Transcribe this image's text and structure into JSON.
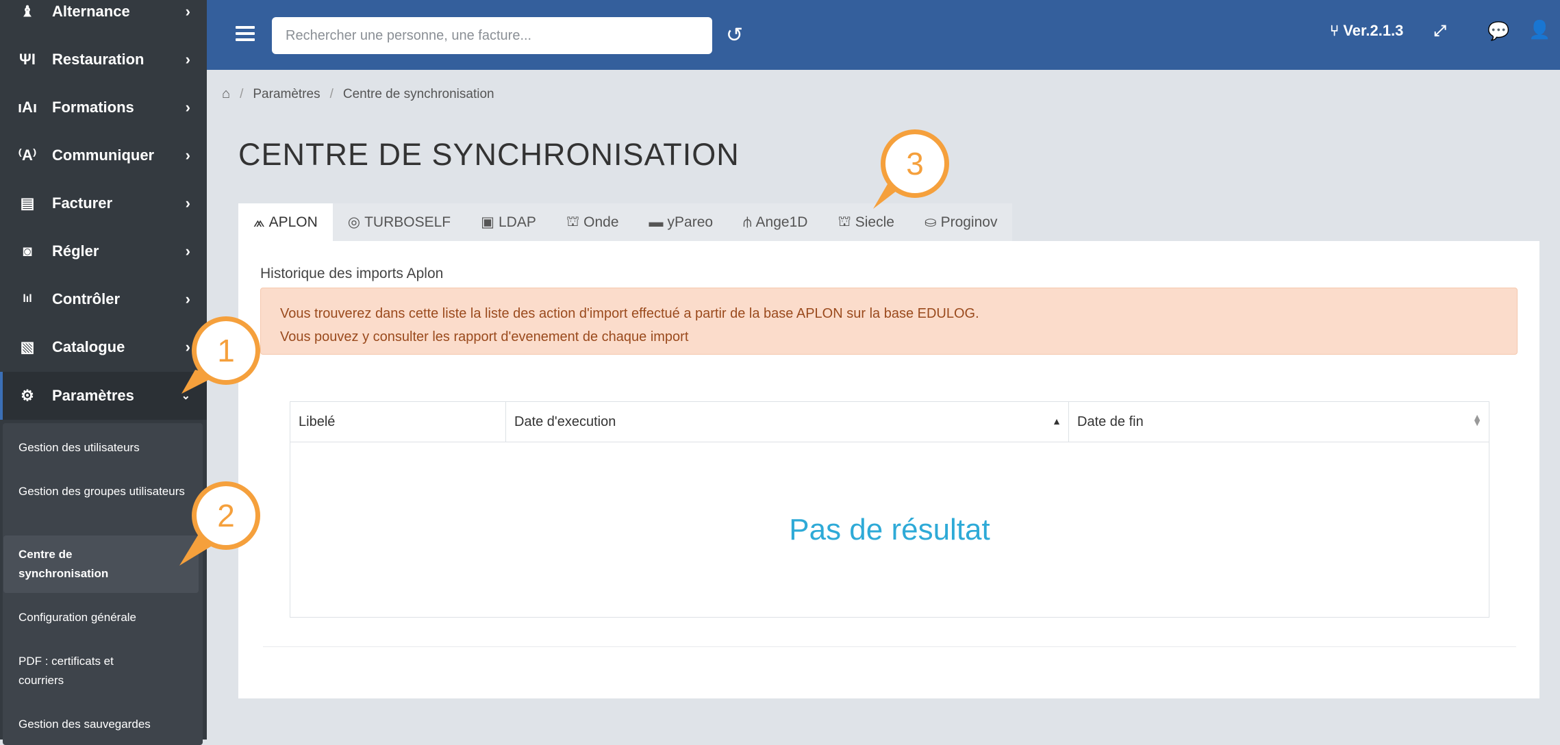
{
  "sidebar": {
    "items": [
      {
        "label": "Alternance",
        "icon": "user-graduate-icon",
        "glyph": "♝"
      },
      {
        "label": "Restauration",
        "icon": "utensils-icon",
        "glyph": "🍴"
      },
      {
        "label": "Formations",
        "icon": "chalkboard-icon",
        "glyph": "▮"
      },
      {
        "label": "Communiquer",
        "icon": "broadcast-icon",
        "glyph": "⌖"
      },
      {
        "label": "Facturer",
        "icon": "invoice-icon",
        "glyph": "▤"
      },
      {
        "label": "Régler",
        "icon": "money-bill-icon",
        "glyph": "◫"
      },
      {
        "label": "Contrôler",
        "icon": "chart-icon",
        "glyph": "▥"
      },
      {
        "label": "Catalogue",
        "icon": "catalog-icon",
        "glyph": "▧"
      },
      {
        "label": "Paramètres",
        "icon": "cogs-icon",
        "glyph": "⚙"
      }
    ],
    "submenu": [
      {
        "label": "Gestion des utilisateurs"
      },
      {
        "label": "Gestion des groupes utilisateurs"
      },
      {
        "label": "Centre de synchronisation"
      },
      {
        "label": "Configuration générale"
      },
      {
        "label": "PDF : certificats et courriers"
      },
      {
        "label": "Gestion des sauvegardes"
      }
    ]
  },
  "topbar": {
    "search_placeholder": "Rechercher une personne, une facture...",
    "version": "Ver.2.1.3"
  },
  "breadcrumb": {
    "items": [
      "Paramètres",
      "Centre de synchronisation"
    ]
  },
  "page": {
    "title": "CENTRE DE SYNCHRONISATION",
    "tabs": [
      {
        "label": "APLON",
        "icon": "aplon-icon",
        "glyph": "⩕"
      },
      {
        "label": "TURBOSELF",
        "icon": "fingerprint-icon",
        "glyph": "◎"
      },
      {
        "label": "LDAP",
        "icon": "address-book-icon",
        "glyph": "▣"
      },
      {
        "label": "Onde",
        "icon": "institution-icon",
        "glyph": "⛫"
      },
      {
        "label": "yPareo",
        "icon": "briefcase-icon",
        "glyph": "▬"
      },
      {
        "label": "Ange1D",
        "icon": "sitemap-icon",
        "glyph": "⫛"
      },
      {
        "label": "Siecle",
        "icon": "institution-icon",
        "glyph": "⛫"
      },
      {
        "label": "Proginov",
        "icon": "hand-holding-icon",
        "glyph": "⛀"
      }
    ],
    "history_label": "Historique des imports Aplon",
    "alert_line1": "Vous trouverez dans cette liste la liste des action d'import effectué a partir de la base APLON sur la base EDULOG.",
    "alert_line2": "Vous pouvez y consulter les rapport d'evenement de chaque import",
    "table": {
      "columns": [
        "Libelé",
        "Date d'execution",
        "Date de fin"
      ],
      "empty": "Pas de résultat"
    }
  },
  "callouts": [
    "1",
    "2",
    "3"
  ],
  "colors": {
    "accent": "#345f9c",
    "callout": "#f5a03c",
    "empty_text": "#2eaad7"
  }
}
